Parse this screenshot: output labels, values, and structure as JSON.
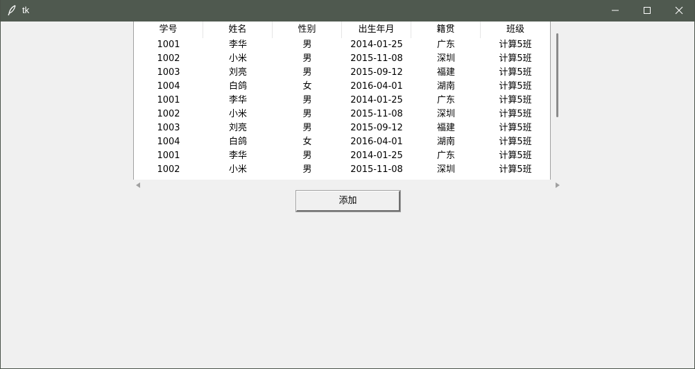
{
  "window": {
    "title": "tk",
    "titlebar_color": "#4f594f",
    "icons": [
      "feather-icon",
      "minimize-icon",
      "maximize-icon",
      "close-icon"
    ]
  },
  "table": {
    "columns": [
      "学号",
      "姓名",
      "性别",
      "出生年月",
      "籍贯",
      "班级"
    ],
    "rows": [
      [
        "1001",
        "李华",
        "男",
        "2014-01-25",
        "广东",
        "计算5班"
      ],
      [
        "1002",
        "小米",
        "男",
        "2015-11-08",
        "深圳",
        "计算5班"
      ],
      [
        "1003",
        "刘亮",
        "男",
        "2015-09-12",
        "福建",
        "计算5班"
      ],
      [
        "1004",
        "白鸽",
        "女",
        "2016-04-01",
        "湖南",
        "计算5班"
      ],
      [
        "1001",
        "李华",
        "男",
        "2014-01-25",
        "广东",
        "计算5班"
      ],
      [
        "1002",
        "小米",
        "男",
        "2015-11-08",
        "深圳",
        "计算5班"
      ],
      [
        "1003",
        "刘亮",
        "男",
        "2015-09-12",
        "福建",
        "计算5班"
      ],
      [
        "1004",
        "白鸽",
        "女",
        "2016-04-01",
        "湖南",
        "计算5班"
      ],
      [
        "1001",
        "李华",
        "男",
        "2014-01-25",
        "广东",
        "计算5班"
      ],
      [
        "1002",
        "小米",
        "男",
        "2015-11-08",
        "深圳",
        "计算5班"
      ]
    ]
  },
  "actions": {
    "add_label": "添加"
  }
}
